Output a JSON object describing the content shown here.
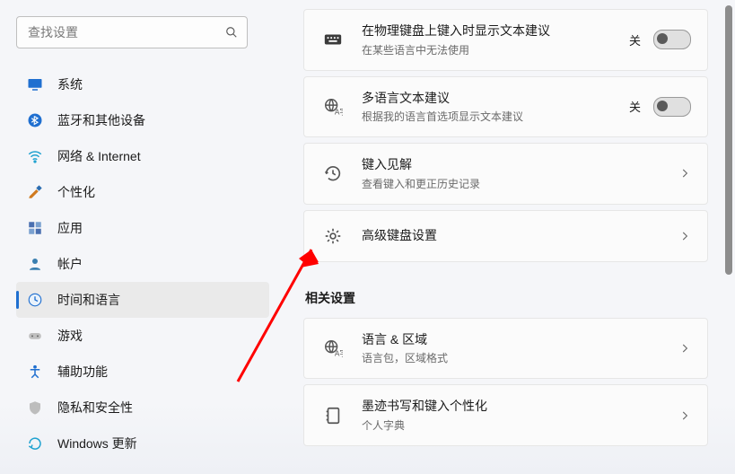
{
  "search": {
    "placeholder": "查找设置"
  },
  "sidebar": {
    "items": [
      {
        "label": "系统",
        "icon": "monitor",
        "color": "#1f6fd0"
      },
      {
        "label": "蓝牙和其他设备",
        "icon": "bluetooth",
        "color": "#1f6fd0"
      },
      {
        "label": "网络 & Internet",
        "icon": "wifi",
        "color": "#1fa2d0"
      },
      {
        "label": "个性化",
        "icon": "brush",
        "color": "#d07a1f"
      },
      {
        "label": "应用",
        "icon": "grid",
        "color": "#4a6fb0"
      },
      {
        "label": "帐户",
        "icon": "person",
        "color": "#3a7fb0"
      },
      {
        "label": "时间和语言",
        "icon": "clock-lang",
        "color": "#1f6fd0",
        "selected": true
      },
      {
        "label": "游戏",
        "icon": "gamepad",
        "color": "#888888"
      },
      {
        "label": "辅助功能",
        "icon": "accessibility",
        "color": "#1f6fd0"
      },
      {
        "label": "隐私和安全性",
        "icon": "shield",
        "color": "#888888"
      },
      {
        "label": "Windows 更新",
        "icon": "update",
        "color": "#1fa2d0"
      }
    ]
  },
  "toggle_off_label": "关",
  "cards": [
    {
      "title": "在物理键盘上键入时显示文本建议",
      "sub": "在某些语言中无法使用",
      "icon": "keyboard",
      "kind": "toggle"
    },
    {
      "title": "多语言文本建议",
      "sub": "根据我的语言首选项显示文本建议",
      "icon": "globe-text",
      "kind": "toggle"
    },
    {
      "title": "键入见解",
      "sub": "查看键入和更正历史记录",
      "icon": "history",
      "kind": "link"
    },
    {
      "title": "高级键盘设置",
      "sub": "",
      "icon": "gear",
      "kind": "link"
    }
  ],
  "related_section_title": "相关设置",
  "related": [
    {
      "title": "语言 & 区域",
      "sub": "语言包，区域格式",
      "icon": "globe-text"
    },
    {
      "title": "墨迹书写和键入个性化",
      "sub": "个人字典",
      "icon": "notebook"
    }
  ]
}
